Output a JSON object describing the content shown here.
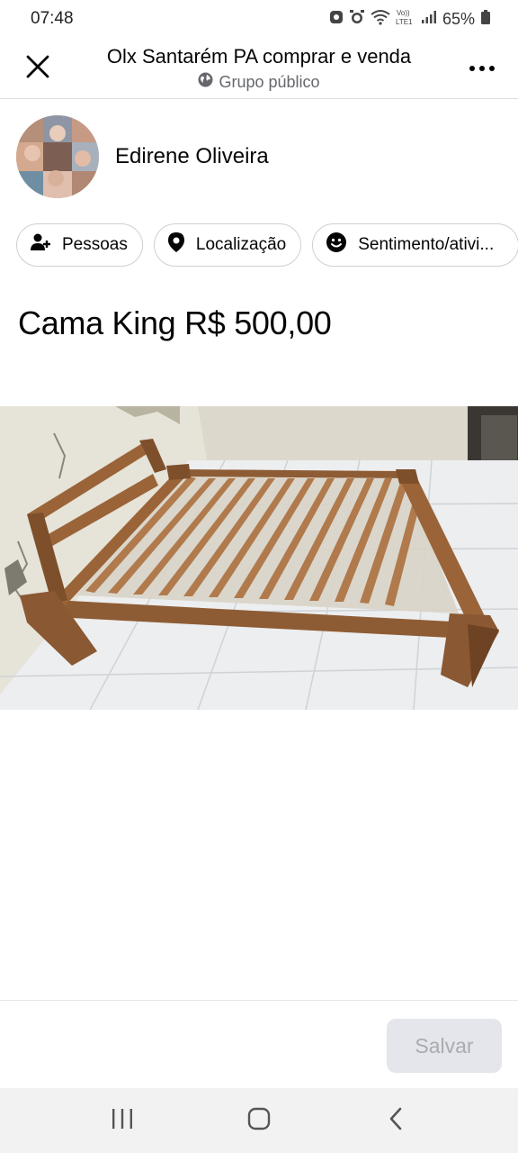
{
  "status_bar": {
    "time": "07:48",
    "battery": "65%",
    "icons": [
      "whatsapp-icon",
      "alarm-icon",
      "wifi-icon",
      "volte-icon",
      "signal-icon",
      "battery-icon"
    ],
    "volte_label": "Vo)) LTE1"
  },
  "header": {
    "title": "Olx Santarém PA comprar e venda",
    "subtitle": "Grupo público",
    "close_icon": "close-icon",
    "more_icon": "more-icon"
  },
  "author": {
    "name": "Edirene Oliveira"
  },
  "chips": [
    {
      "label": "Pessoas",
      "icon": "people-icon"
    },
    {
      "label": "Localização",
      "icon": "location-icon"
    },
    {
      "label": "Sentimento/ativi...",
      "icon": "emoji-icon"
    }
  ],
  "post": {
    "text": "Cama King R$ 500,00"
  },
  "footer": {
    "save_label": "Salvar"
  },
  "colors": {
    "text": "#050505",
    "secondary_text": "#65676b",
    "divider": "#dadde1",
    "disabled_button": "#e4e6eb",
    "disabled_text": "#a8abaf"
  }
}
